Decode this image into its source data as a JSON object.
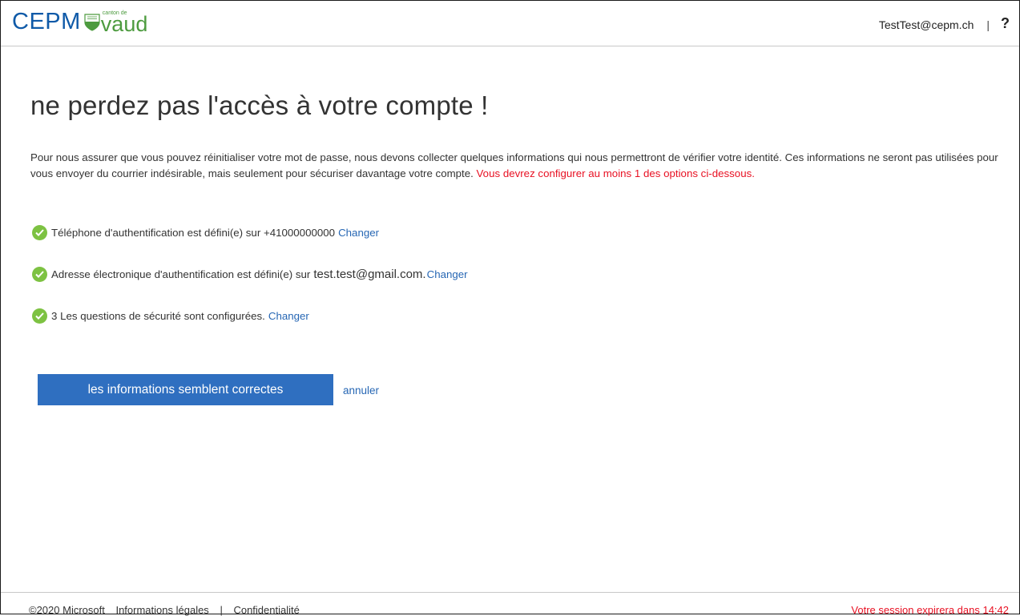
{
  "header": {
    "logo_text": "CEPM",
    "canton_label": "canton de",
    "vaud_label": "vaud",
    "user_email": "TestTest@cepm.ch",
    "separator": "|",
    "help_label": "?"
  },
  "main": {
    "title": "ne perdez pas l'accès à votre compte !",
    "intro_text": "Pour nous assurer que vous pouvez réinitialiser votre mot de passe, nous devons collecter quelques informations qui nous permettront de vérifier votre identité. Ces informations ne seront pas utilisées pour vous envoyer du courrier indésirable, mais seulement pour sécuriser davantage votre compte.",
    "warning_text": "Vous devrez configurer au moins 1 des options ci-dessous.",
    "items": [
      {
        "text": "Téléphone d'authentification est défini(e) sur +41000000000",
        "link": "Changer"
      },
      {
        "text": "Adresse électronique d'authentification est défini(e) sur",
        "value": "test.test@gmail.com.",
        "link": "Changer"
      },
      {
        "text": "3 Les questions de sécurité sont configurées.",
        "link": "Changer"
      }
    ],
    "confirm_button": "les informations semblent correctes",
    "cancel_link": "annuler"
  },
  "footer": {
    "copyright": "©2020 Microsoft",
    "legal": "Informations légales",
    "separator": "|",
    "privacy": "Confidentialité",
    "session": "Votre session expirera dans 14:42"
  },
  "colors": {
    "accent": "#2f6fc0",
    "link": "#2767b4",
    "warning": "#e81123",
    "success": "#7dc242",
    "logo_blue": "#0f5aa8",
    "logo_green": "#4d9b3f"
  }
}
